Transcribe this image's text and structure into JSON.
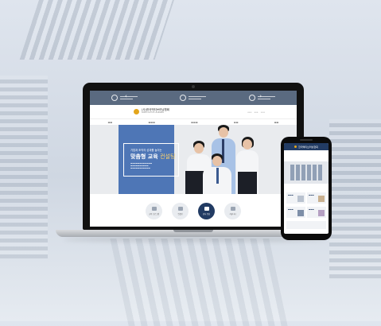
{
  "laptop": {
    "logo_name": "(사)한국액티브러닝협회",
    "logo_sub": "KOREA ACTIVE LEARNING",
    "hero": {
      "subtitle": "기업과 조직의 성과를 높이는",
      "title_main": "맞춤형 교육",
      "title_accent": "컨설팅"
    },
    "services": [
      {
        "label": "교육 프로그램"
      },
      {
        "label": "컨설팅"
      },
      {
        "label": "강사 양성"
      },
      {
        "label": "커뮤니티"
      }
    ]
  },
  "phone": {
    "logo": "한국액티브러닝협회"
  },
  "colors": {
    "topbar": "#5a6a80",
    "hero_blue": "#4e76b6",
    "active_service": "#223b63",
    "logo_gold": "#e3a51b"
  }
}
